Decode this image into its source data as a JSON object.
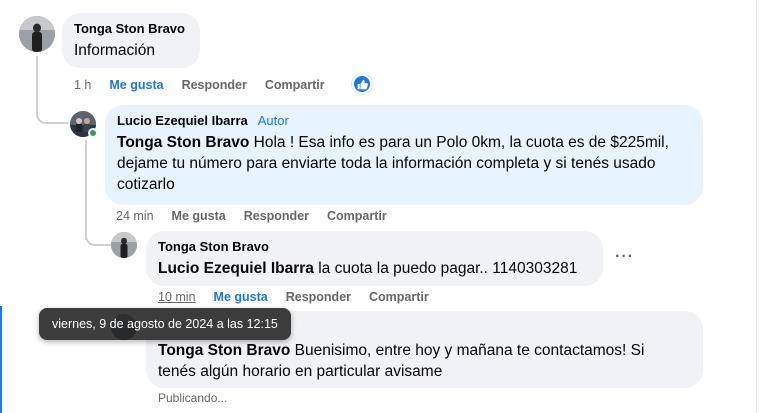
{
  "comments": [
    {
      "author": "Tonga Ston Bravo",
      "text": "Información",
      "actions": {
        "time": "1 h",
        "like": "Me gusta",
        "reply": "Responder",
        "share": "Compartir"
      }
    },
    {
      "author": "Lucio Ezequiel Ibarra",
      "badge": "Autor",
      "mention": "Tonga Ston Bravo",
      "text_line1": " Hola ! Esa info es para un Polo 0km, la cuota es de $225mil,",
      "text_line2": "dejame tu número para enviarte toda la información completa y si tenés usado",
      "text_line3": "cotizarlo",
      "actions": {
        "time": "24 min",
        "like": "Me gusta",
        "reply": "Responder",
        "share": "Compartir"
      }
    },
    {
      "author": "Tonga Ston Bravo",
      "mention": "Lucio Ezequiel Ibarra",
      "text": " la cuota la puedo pagar.. 1140303281",
      "actions": {
        "time": "10 min",
        "like": "Me gusta",
        "reply": "Responder",
        "share": "Compartir"
      }
    },
    {
      "mention": "Tonga Ston Bravo",
      "text_line1": " Buenisimo, entre hoy y mañana te contactamos! Si",
      "text_line2": "tenés algún horario en particular avisame",
      "status": "Publicando..."
    }
  ],
  "tooltip": "viernes, 9 de agosto de 2024 a las 12:15",
  "colors": {
    "accent": "#1877f2",
    "author_bubble": "#e7f3ff",
    "bubble": "#f0f2f5",
    "online": "#31a24c"
  },
  "icons": {
    "like_badge": "thumbs-up-icon",
    "more": "more-options-icon"
  }
}
